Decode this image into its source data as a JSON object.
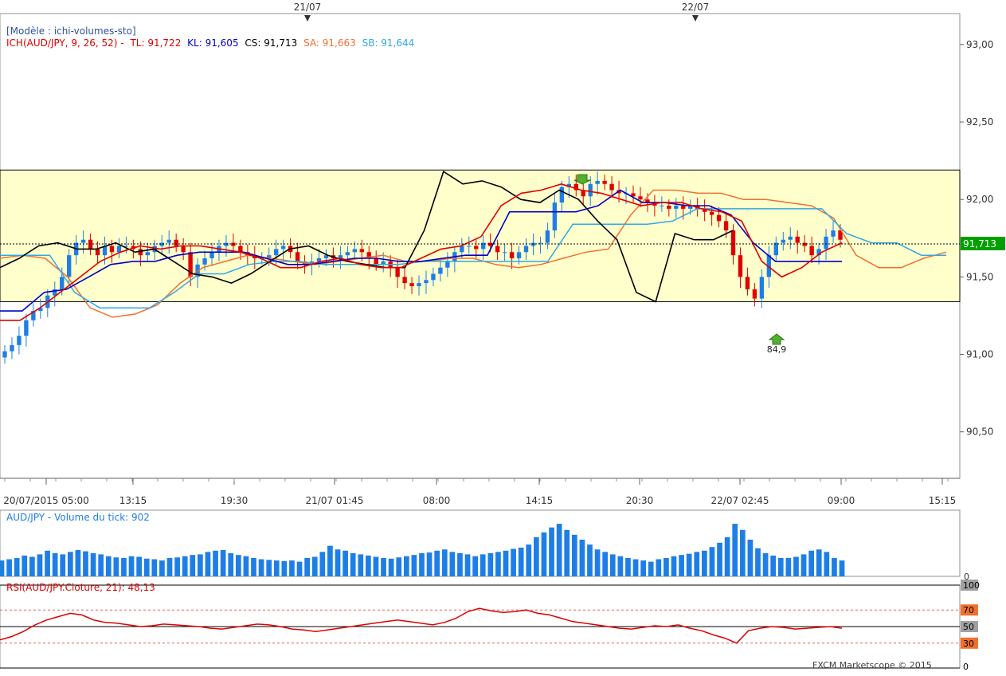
{
  "header": {
    "template_label": "[Modèle : ichi-volumes-sto]",
    "indicator_prefix": "ICH(AUD/JPY, 9, 26, 52) -",
    "tl": "TL: 91,722",
    "kl": "KL: 91,605",
    "cs": "CS: 91,713",
    "sa": "SA: 91,663",
    "sb": "SB: 91,644"
  },
  "colors": {
    "tl": "#e00000",
    "kl": "#0000c8",
    "cs": "#000000",
    "sa": "#f07030",
    "sb": "#30a8e8",
    "cloud_fill": "#ffffcc",
    "price_badge": "#00a000",
    "volume": "#1e7ee6",
    "rsi": "#e00000",
    "rsi_badge_70": "#f07030",
    "rsi_badge_30": "#f07030",
    "rsi_badge_gray": "#a0a0a0"
  },
  "top_dates": [
    "21/07",
    "22/07"
  ],
  "chart_data": [
    {
      "type": "candlestick",
      "title": "ICH(AUD/JPY, 9, 26, 52)",
      "y_ticks": [
        "93,00",
        "92,50",
        "92,00",
        "91,50",
        "91,00",
        "90,50"
      ],
      "ylim": [
        90.2,
        93.2
      ],
      "x_ticks": [
        "20/07/2015 05:00",
        "13:15",
        "19:30",
        "21/07 01:45",
        "08:00",
        "14:15",
        "20:30",
        "22/07 02:45",
        "09:00",
        "15:15"
      ],
      "last_price": "91,713",
      "range_box": {
        "top": 92.19,
        "bottom": 91.34
      },
      "annotations": [
        {
          "text": "84,9",
          "type": "buy-arrow"
        }
      ],
      "series_close": [
        91.02,
        91.06,
        91.12,
        91.22,
        91.28,
        91.3,
        91.38,
        91.42,
        91.5,
        91.64,
        91.72,
        91.74,
        91.68,
        91.64,
        91.7,
        91.66,
        91.7,
        91.7,
        91.68,
        91.64,
        91.66,
        91.7,
        91.72,
        91.74,
        91.7,
        91.66,
        91.5,
        91.58,
        91.62,
        91.66,
        91.7,
        91.72,
        91.7,
        91.66,
        91.64,
        91.62,
        91.62,
        91.64,
        91.68,
        91.7,
        91.66,
        91.6,
        91.58,
        91.6,
        91.62,
        91.64,
        91.62,
        91.64,
        91.66,
        91.68,
        91.66,
        91.62,
        91.58,
        91.6,
        91.56,
        91.5,
        91.46,
        91.44,
        91.46,
        91.48,
        91.52,
        91.56,
        91.6,
        91.66,
        91.7,
        91.7,
        91.68,
        91.72,
        91.7,
        91.66,
        91.66,
        91.62,
        91.66,
        91.7,
        91.72,
        91.72,
        91.8,
        91.98,
        92.08,
        92.1,
        92.06,
        92.02,
        92.1,
        92.12,
        92.1,
        92.06,
        92.04,
        92.04,
        92.02,
        92.0,
        91.98,
        91.96,
        91.96,
        91.94,
        91.96,
        91.94,
        91.96,
        91.94,
        91.92,
        91.9,
        91.86,
        91.8,
        91.64,
        91.5,
        91.42,
        91.36,
        91.5,
        91.64,
        91.72,
        91.74,
        91.76,
        91.72,
        91.7,
        91.64,
        91.68,
        91.76,
        91.8,
        91.74
      ],
      "series": [
        {
          "name": "TL",
          "values": [
            91.22,
            91.22,
            91.3,
            91.4,
            91.5,
            91.6,
            91.66,
            91.7,
            91.68,
            91.7,
            91.7,
            91.68,
            91.66,
            91.62,
            91.56,
            91.56,
            91.6,
            91.62,
            91.58,
            91.56,
            91.56,
            91.62,
            91.68,
            91.7,
            91.76,
            91.96,
            92.04,
            92.06,
            92.1,
            92.06,
            92.04,
            92.0,
            91.96,
            91.98,
            91.98,
            91.94,
            91.92,
            91.86,
            91.6,
            91.5,
            91.56,
            91.66,
            91.72
          ]
        },
        {
          "name": "KL",
          "values": [
            91.28,
            91.28,
            91.4,
            91.42,
            91.5,
            91.58,
            91.6,
            91.6,
            91.64,
            91.66,
            91.66,
            91.66,
            91.62,
            91.58,
            91.58,
            91.6,
            91.62,
            91.62,
            91.6,
            91.6,
            91.62,
            91.64,
            91.64,
            91.92,
            91.92,
            91.92,
            91.92,
            91.96,
            92.06,
            91.98,
            91.98,
            91.96,
            91.96,
            91.9,
            91.72,
            91.6,
            91.6,
            91.6,
            91.6
          ]
        },
        {
          "name": "CS",
          "values": [
            91.56,
            91.62,
            91.7,
            91.72,
            91.68,
            91.68,
            91.72,
            91.66,
            91.68,
            91.6,
            91.52,
            91.5,
            91.46,
            91.52,
            91.6,
            91.68,
            91.7,
            91.64,
            91.6,
            91.58,
            91.56,
            91.56,
            91.8,
            92.18,
            92.1,
            92.12,
            92.08,
            92.0,
            91.98,
            92.06,
            92.0,
            91.86,
            91.74,
            91.4,
            91.34,
            91.78,
            91.74,
            91.74,
            91.8
          ]
        },
        {
          "name": "SA",
          "values": [
            91.62,
            91.64,
            91.62,
            91.5,
            91.3,
            91.24,
            91.26,
            91.32,
            91.46,
            91.56,
            91.6,
            91.64,
            91.62,
            91.6,
            91.58,
            91.6,
            91.62,
            91.64,
            91.6,
            91.6,
            91.62,
            91.62,
            91.58,
            91.56,
            91.58,
            91.62,
            91.66,
            91.68,
            91.9,
            92.06,
            92.06,
            92.04,
            92.04,
            92.0,
            92.0,
            91.98,
            91.96,
            91.88,
            91.64,
            91.56,
            91.56,
            91.62,
            91.66
          ]
        },
        {
          "name": "SB",
          "values": [
            91.64,
            91.64,
            91.64,
            91.4,
            91.3,
            91.3,
            91.3,
            91.4,
            91.52,
            91.52,
            91.58,
            91.6,
            91.6,
            91.58,
            91.58,
            91.58,
            91.58,
            91.6,
            91.6,
            91.6,
            91.6,
            91.6,
            91.6,
            91.84,
            91.84,
            91.84,
            91.84,
            91.86,
            91.94,
            91.94,
            91.94,
            91.94,
            91.94,
            91.94,
            91.78,
            91.72,
            91.72,
            91.64,
            91.64
          ]
        }
      ]
    },
    {
      "type": "bar",
      "title": "AUD/JPY - Volume du tick: 902",
      "y_ticks": [
        "0"
      ],
      "values": [
        260,
        280,
        300,
        340,
        320,
        360,
        420,
        380,
        360,
        400,
        430,
        410,
        380,
        360,
        330,
        310,
        300,
        330,
        320,
        290,
        280,
        260,
        300,
        310,
        330,
        350,
        360,
        400,
        420,
        430,
        380,
        350,
        330,
        300,
        280,
        270,
        260,
        250,
        260,
        240,
        300,
        320,
        400,
        500,
        440,
        420,
        380,
        360,
        340,
        320,
        300,
        290,
        310,
        330,
        350,
        380,
        390,
        420,
        440,
        400,
        380,
        360,
        330,
        360,
        380,
        400,
        420,
        450,
        470,
        520,
        640,
        720,
        800,
        860,
        760,
        680,
        600,
        520,
        440,
        400,
        360,
        330,
        300,
        280,
        260,
        240,
        280,
        300,
        330,
        350,
        370,
        400,
        420,
        480,
        550,
        640,
        860,
        760,
        600,
        460,
        380,
        340,
        300,
        300,
        320,
        360,
        420,
        440,
        400,
        300,
        260
      ]
    },
    {
      "type": "line",
      "title": "RSI(AUD/JPY.Cloture, 21): 48,13",
      "y_ticks": [
        "100",
        "70",
        "50",
        "30",
        "0"
      ],
      "ylim": [
        0,
        100
      ],
      "levels": [
        70,
        50,
        30
      ],
      "values": [
        34,
        38,
        44,
        52,
        58,
        62,
        66,
        64,
        58,
        55,
        54,
        52,
        50,
        51,
        53,
        52,
        51,
        50,
        48,
        47,
        49,
        51,
        53,
        52,
        50,
        47,
        46,
        44,
        46,
        48,
        50,
        52,
        54,
        56,
        58,
        56,
        54,
        52,
        55,
        60,
        68,
        72,
        69,
        67,
        68,
        70,
        66,
        64,
        60,
        56,
        54,
        52,
        50,
        48,
        47,
        49,
        51,
        50,
        52,
        48,
        45,
        40,
        36,
        30,
        45,
        48,
        50,
        49,
        47,
        48,
        49,
        50,
        48
      ],
      "footer": "FXCM Marketscope © 2015"
    }
  ]
}
